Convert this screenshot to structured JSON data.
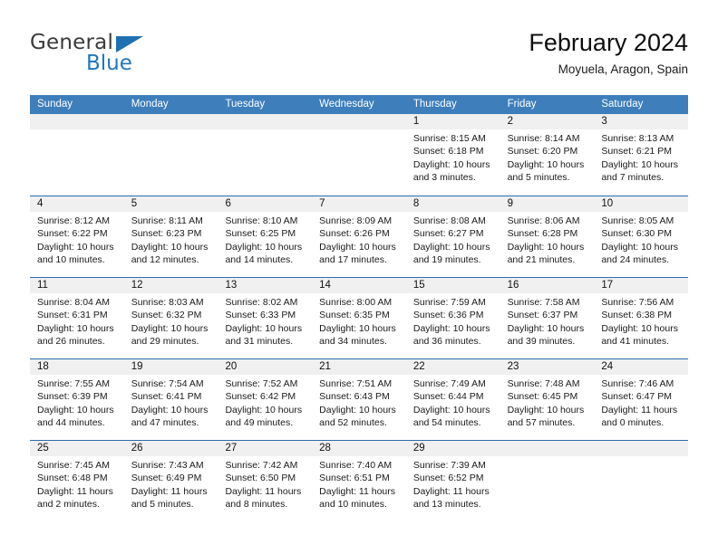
{
  "brand": {
    "name_top": "General",
    "name_bottom": "Blue",
    "accent_color": "#2077BC"
  },
  "header": {
    "title": "February 2024",
    "location": "Moyuela, Aragon, Spain"
  },
  "calendar": {
    "header_bg": "#3D7EBB",
    "row_divider_color": "#2E6DA8",
    "daynum_band_color": "#F0F0F0",
    "weekdays": [
      "Sunday",
      "Monday",
      "Tuesday",
      "Wednesday",
      "Thursday",
      "Friday",
      "Saturday"
    ],
    "weeks": [
      [
        {
          "empty": true
        },
        {
          "empty": true
        },
        {
          "empty": true
        },
        {
          "empty": true
        },
        {
          "day": "1",
          "sunrise": "Sunrise: 8:15 AM",
          "sunset": "Sunset: 6:18 PM",
          "daylight_1": "Daylight: 10 hours",
          "daylight_2": "and 3 minutes."
        },
        {
          "day": "2",
          "sunrise": "Sunrise: 8:14 AM",
          "sunset": "Sunset: 6:20 PM",
          "daylight_1": "Daylight: 10 hours",
          "daylight_2": "and 5 minutes."
        },
        {
          "day": "3",
          "sunrise": "Sunrise: 8:13 AM",
          "sunset": "Sunset: 6:21 PM",
          "daylight_1": "Daylight: 10 hours",
          "daylight_2": "and 7 minutes."
        }
      ],
      [
        {
          "day": "4",
          "sunrise": "Sunrise: 8:12 AM",
          "sunset": "Sunset: 6:22 PM",
          "daylight_1": "Daylight: 10 hours",
          "daylight_2": "and 10 minutes."
        },
        {
          "day": "5",
          "sunrise": "Sunrise: 8:11 AM",
          "sunset": "Sunset: 6:23 PM",
          "daylight_1": "Daylight: 10 hours",
          "daylight_2": "and 12 minutes."
        },
        {
          "day": "6",
          "sunrise": "Sunrise: 8:10 AM",
          "sunset": "Sunset: 6:25 PM",
          "daylight_1": "Daylight: 10 hours",
          "daylight_2": "and 14 minutes."
        },
        {
          "day": "7",
          "sunrise": "Sunrise: 8:09 AM",
          "sunset": "Sunset: 6:26 PM",
          "daylight_1": "Daylight: 10 hours",
          "daylight_2": "and 17 minutes."
        },
        {
          "day": "8",
          "sunrise": "Sunrise: 8:08 AM",
          "sunset": "Sunset: 6:27 PM",
          "daylight_1": "Daylight: 10 hours",
          "daylight_2": "and 19 minutes."
        },
        {
          "day": "9",
          "sunrise": "Sunrise: 8:06 AM",
          "sunset": "Sunset: 6:28 PM",
          "daylight_1": "Daylight: 10 hours",
          "daylight_2": "and 21 minutes."
        },
        {
          "day": "10",
          "sunrise": "Sunrise: 8:05 AM",
          "sunset": "Sunset: 6:30 PM",
          "daylight_1": "Daylight: 10 hours",
          "daylight_2": "and 24 minutes."
        }
      ],
      [
        {
          "day": "11",
          "sunrise": "Sunrise: 8:04 AM",
          "sunset": "Sunset: 6:31 PM",
          "daylight_1": "Daylight: 10 hours",
          "daylight_2": "and 26 minutes."
        },
        {
          "day": "12",
          "sunrise": "Sunrise: 8:03 AM",
          "sunset": "Sunset: 6:32 PM",
          "daylight_1": "Daylight: 10 hours",
          "daylight_2": "and 29 minutes."
        },
        {
          "day": "13",
          "sunrise": "Sunrise: 8:02 AM",
          "sunset": "Sunset: 6:33 PM",
          "daylight_1": "Daylight: 10 hours",
          "daylight_2": "and 31 minutes."
        },
        {
          "day": "14",
          "sunrise": "Sunrise: 8:00 AM",
          "sunset": "Sunset: 6:35 PM",
          "daylight_1": "Daylight: 10 hours",
          "daylight_2": "and 34 minutes."
        },
        {
          "day": "15",
          "sunrise": "Sunrise: 7:59 AM",
          "sunset": "Sunset: 6:36 PM",
          "daylight_1": "Daylight: 10 hours",
          "daylight_2": "and 36 minutes."
        },
        {
          "day": "16",
          "sunrise": "Sunrise: 7:58 AM",
          "sunset": "Sunset: 6:37 PM",
          "daylight_1": "Daylight: 10 hours",
          "daylight_2": "and 39 minutes."
        },
        {
          "day": "17",
          "sunrise": "Sunrise: 7:56 AM",
          "sunset": "Sunset: 6:38 PM",
          "daylight_1": "Daylight: 10 hours",
          "daylight_2": "and 41 minutes."
        }
      ],
      [
        {
          "day": "18",
          "sunrise": "Sunrise: 7:55 AM",
          "sunset": "Sunset: 6:39 PM",
          "daylight_1": "Daylight: 10 hours",
          "daylight_2": "and 44 minutes."
        },
        {
          "day": "19",
          "sunrise": "Sunrise: 7:54 AM",
          "sunset": "Sunset: 6:41 PM",
          "daylight_1": "Daylight: 10 hours",
          "daylight_2": "and 47 minutes."
        },
        {
          "day": "20",
          "sunrise": "Sunrise: 7:52 AM",
          "sunset": "Sunset: 6:42 PM",
          "daylight_1": "Daylight: 10 hours",
          "daylight_2": "and 49 minutes."
        },
        {
          "day": "21",
          "sunrise": "Sunrise: 7:51 AM",
          "sunset": "Sunset: 6:43 PM",
          "daylight_1": "Daylight: 10 hours",
          "daylight_2": "and 52 minutes."
        },
        {
          "day": "22",
          "sunrise": "Sunrise: 7:49 AM",
          "sunset": "Sunset: 6:44 PM",
          "daylight_1": "Daylight: 10 hours",
          "daylight_2": "and 54 minutes."
        },
        {
          "day": "23",
          "sunrise": "Sunrise: 7:48 AM",
          "sunset": "Sunset: 6:45 PM",
          "daylight_1": "Daylight: 10 hours",
          "daylight_2": "and 57 minutes."
        },
        {
          "day": "24",
          "sunrise": "Sunrise: 7:46 AM",
          "sunset": "Sunset: 6:47 PM",
          "daylight_1": "Daylight: 11 hours",
          "daylight_2": "and 0 minutes."
        }
      ],
      [
        {
          "day": "25",
          "sunrise": "Sunrise: 7:45 AM",
          "sunset": "Sunset: 6:48 PM",
          "daylight_1": "Daylight: 11 hours",
          "daylight_2": "and 2 minutes."
        },
        {
          "day": "26",
          "sunrise": "Sunrise: 7:43 AM",
          "sunset": "Sunset: 6:49 PM",
          "daylight_1": "Daylight: 11 hours",
          "daylight_2": "and 5 minutes."
        },
        {
          "day": "27",
          "sunrise": "Sunrise: 7:42 AM",
          "sunset": "Sunset: 6:50 PM",
          "daylight_1": "Daylight: 11 hours",
          "daylight_2": "and 8 minutes."
        },
        {
          "day": "28",
          "sunrise": "Sunrise: 7:40 AM",
          "sunset": "Sunset: 6:51 PM",
          "daylight_1": "Daylight: 11 hours",
          "daylight_2": "and 10 minutes."
        },
        {
          "day": "29",
          "sunrise": "Sunrise: 7:39 AM",
          "sunset": "Sunset: 6:52 PM",
          "daylight_1": "Daylight: 11 hours",
          "daylight_2": "and 13 minutes."
        },
        {
          "empty": true
        },
        {
          "empty": true
        }
      ]
    ]
  }
}
